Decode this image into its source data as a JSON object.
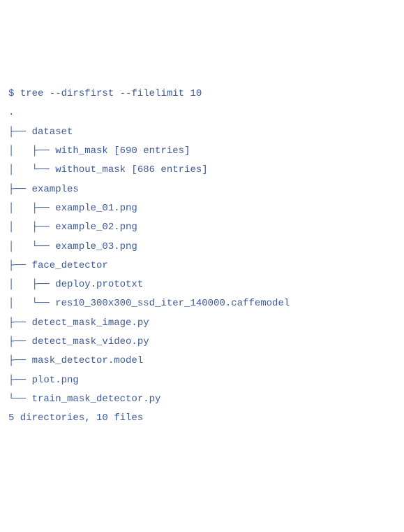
{
  "command": {
    "prompt": "$",
    "text": "tree --dirsfirst --filelimit 10"
  },
  "root": ".",
  "lines": [
    {
      "prefix": "├── ",
      "name": "dataset"
    },
    {
      "prefix": "│   ├── ",
      "name": "with_mask [690 entries]"
    },
    {
      "prefix": "│   └── ",
      "name": "without_mask [686 entries]"
    },
    {
      "prefix": "├── ",
      "name": "examples"
    },
    {
      "prefix": "│   ├── ",
      "name": "example_01.png"
    },
    {
      "prefix": "│   ├── ",
      "name": "example_02.png"
    },
    {
      "prefix": "│   └── ",
      "name": "example_03.png"
    },
    {
      "prefix": "├── ",
      "name": "face_detector"
    },
    {
      "prefix": "│   ├── ",
      "name": "deploy.prototxt"
    },
    {
      "prefix": "│   └── ",
      "name": "res10_300x300_ssd_iter_140000.caffemodel"
    },
    {
      "prefix": "├── ",
      "name": "detect_mask_image.py"
    },
    {
      "prefix": "├── ",
      "name": "detect_mask_video.py"
    },
    {
      "prefix": "├── ",
      "name": "mask_detector.model"
    },
    {
      "prefix": "├── ",
      "name": "plot.png"
    },
    {
      "prefix": "└── ",
      "name": "train_mask_detector.py"
    }
  ],
  "summary": "5 directories, 10 files"
}
